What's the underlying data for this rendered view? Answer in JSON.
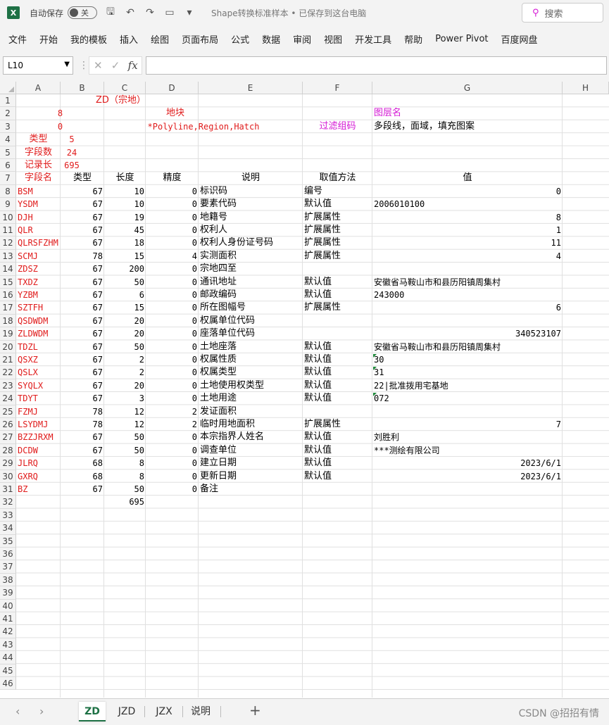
{
  "titlebar": {
    "autosave_label": "自动保存",
    "autosave_state": "关",
    "document_title": "Shape转换标准样本 • 已保存到这台电脑",
    "search_placeholder": "搜索"
  },
  "ribbon": {
    "tabs": [
      "文件",
      "开始",
      "我的模板",
      "插入",
      "绘图",
      "页面布局",
      "公式",
      "数据",
      "审阅",
      "视图",
      "开发工具",
      "帮助",
      "Power Pivot",
      "百度网盘"
    ]
  },
  "formula_bar": {
    "name_box": "L10",
    "formula": ""
  },
  "grid": {
    "columns": [
      "A",
      "B",
      "C",
      "D",
      "E",
      "F",
      "G",
      "H"
    ],
    "rows": [
      "1",
      "2",
      "3",
      "4",
      "5",
      "6",
      "7",
      "8",
      "9",
      "10",
      "11",
      "12",
      "13",
      "14",
      "15",
      "16",
      "17",
      "18",
      "19",
      "20",
      "21",
      "22",
      "23",
      "24",
      "25",
      "26",
      "27",
      "28",
      "29",
      "30",
      "31",
      "32",
      "33",
      "34",
      "35",
      "36",
      "37",
      "38",
      "39",
      "40",
      "41",
      "42",
      "43",
      "44",
      "45",
      "46"
    ],
    "header_area": {
      "title": "ZD（宗地）",
      "r2_a": "8",
      "r2_c": "地块",
      "r2_g": "图层名",
      "r3_a": "0",
      "r3_c": "*Polyline,Region,Hatch",
      "r3_f": "过滤组码",
      "r3_g": "多段线，面域，填充图案",
      "r4_a": "类型",
      "r4_b": "5",
      "r5_a": "字段数",
      "r5_b": "24",
      "r6_a": "记录长",
      "r6_b": "695"
    },
    "table_headers": [
      "字段名",
      "类型",
      "长度",
      "精度",
      "说明",
      "取值方法",
      "值"
    ],
    "fields": [
      {
        "name": "BSM",
        "type": "67",
        "len": "10",
        "prec": "0",
        "desc": "标识码",
        "method": "编号",
        "value": "0",
        "align": "r"
      },
      {
        "name": "YSDM",
        "type": "67",
        "len": "10",
        "prec": "0",
        "desc": "要素代码",
        "method": "默认值",
        "value": "2006010100",
        "align": "l"
      },
      {
        "name": "DJH",
        "type": "67",
        "len": "19",
        "prec": "0",
        "desc": "地籍号",
        "method": "扩展属性",
        "value": "8",
        "align": "r"
      },
      {
        "name": "QLR",
        "type": "67",
        "len": "45",
        "prec": "0",
        "desc": "权利人",
        "method": "扩展属性",
        "value": "1",
        "align": "r"
      },
      {
        "name": "QLRSFZHM",
        "type": "67",
        "len": "18",
        "prec": "0",
        "desc": "权利人身份证号码",
        "method": "扩展属性",
        "value": "11",
        "align": "r"
      },
      {
        "name": "SCMJ",
        "type": "78",
        "len": "15",
        "prec": "4",
        "desc": "实测面积",
        "method": "扩展属性",
        "value": "4",
        "align": "r"
      },
      {
        "name": "ZDSZ",
        "type": "67",
        "len": "200",
        "prec": "0",
        "desc": "宗地四至",
        "method": "",
        "value": "",
        "align": "l"
      },
      {
        "name": "TXDZ",
        "type": "67",
        "len": "50",
        "prec": "0",
        "desc": "通讯地址",
        "method": "默认值",
        "value": "安徽省马鞍山市和县历阳镇周集村",
        "align": "l"
      },
      {
        "name": "YZBM",
        "type": "67",
        "len": "6",
        "prec": "0",
        "desc": "邮政编码",
        "method": "默认值",
        "value": "243000",
        "align": "l"
      },
      {
        "name": "SZTFH",
        "type": "67",
        "len": "15",
        "prec": "0",
        "desc": "所在图幅号",
        "method": "扩展属性",
        "value": "6",
        "align": "r"
      },
      {
        "name": "QSDWDM",
        "type": "67",
        "len": "20",
        "prec": "0",
        "desc": "权属单位代码",
        "method": "",
        "value": "",
        "align": "l"
      },
      {
        "name": "ZLDWDM",
        "type": "67",
        "len": "20",
        "prec": "0",
        "desc": "座落单位代码",
        "method": "",
        "value": "340523107",
        "align": "r"
      },
      {
        "name": "TDZL",
        "type": "67",
        "len": "50",
        "prec": "0",
        "desc": "土地座落",
        "method": "默认值",
        "value": "安徽省马鞍山市和县历阳镇周集村",
        "align": "l"
      },
      {
        "name": "QSXZ",
        "type": "67",
        "len": "2",
        "prec": "0",
        "desc": "权属性质",
        "method": "默认值",
        "value": "30",
        "align": "l",
        "flag": true
      },
      {
        "name": "QSLX",
        "type": "67",
        "len": "2",
        "prec": "0",
        "desc": "权属类型",
        "method": "默认值",
        "value": "31",
        "align": "l",
        "flag": true
      },
      {
        "name": "SYQLX",
        "type": "67",
        "len": "20",
        "prec": "0",
        "desc": "土地使用权类型",
        "method": "默认值",
        "value": "22|批准拨用宅基地",
        "align": "l"
      },
      {
        "name": "TDYT",
        "type": "67",
        "len": "3",
        "prec": "0",
        "desc": "土地用途",
        "method": "默认值",
        "value": "072",
        "align": "l",
        "flag": true
      },
      {
        "name": "FZMJ",
        "type": "78",
        "len": "12",
        "prec": "2",
        "desc": "发证面积",
        "method": "",
        "value": "",
        "align": "l"
      },
      {
        "name": "LSYDMJ",
        "type": "78",
        "len": "12",
        "prec": "2",
        "desc": "临时用地面积",
        "method": "扩展属性",
        "value": "7",
        "align": "r"
      },
      {
        "name": "BZZJRXM",
        "type": "67",
        "len": "50",
        "prec": "0",
        "desc": "本宗指界人姓名",
        "method": "默认值",
        "value": "刘胜利",
        "align": "l"
      },
      {
        "name": "DCDW",
        "type": "67",
        "len": "50",
        "prec": "0",
        "desc": "调查单位",
        "method": "默认值",
        "value": "***测绘有限公司",
        "align": "l"
      },
      {
        "name": "JLRQ",
        "type": "68",
        "len": "8",
        "prec": "0",
        "desc": "建立日期",
        "method": "默认值",
        "value": "2023/6/1",
        "align": "r"
      },
      {
        "name": "GXRQ",
        "type": "68",
        "len": "8",
        "prec": "0",
        "desc": "更新日期",
        "method": "默认值",
        "value": "2023/6/1",
        "align": "r"
      },
      {
        "name": "BZ",
        "type": "67",
        "len": "50",
        "prec": "0",
        "desc": "备注",
        "method": "",
        "value": "",
        "align": "l"
      }
    ],
    "total_length": "695"
  },
  "sheets": {
    "tabs": [
      "ZD",
      "JZD",
      "JZX",
      "说明"
    ],
    "active": "ZD",
    "add_label": "+",
    "nav_prev": "‹",
    "nav_next": "›"
  },
  "watermark": "CSDN @招招有情"
}
